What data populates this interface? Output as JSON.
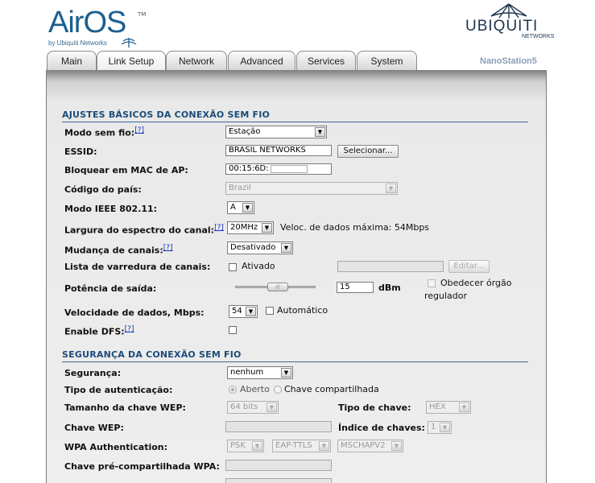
{
  "header": {
    "airos_logo": "AirOS",
    "airos_tm": "TM",
    "airos_sub": "by Ubiquiti Networks",
    "ubnt_logo": "UBIQUITI",
    "ubnt_sub": "NETWORKS",
    "device_name": "NanoStation5"
  },
  "tabs": [
    "Main",
    "Link Setup",
    "Network",
    "Advanced",
    "Services",
    "System"
  ],
  "wireless": {
    "title": "AJUSTES BÁSICOS DA CONEXÃO SEM FIO",
    "mode_label": "Modo sem fio:",
    "help": "[?]",
    "mode_value": "Estação",
    "essid_label": "ESSID:",
    "essid_value": "BRASIL NETWORKS",
    "select_button": "Selecionar...",
    "lock_label": "Bloquear em MAC de AP:",
    "lock_value": "00:15:6D:",
    "country_label": "Código do país:",
    "country_value": "Brazil",
    "ieee_label": "Modo IEEE 802.11:",
    "ieee_value": "A",
    "width_label": "Largura do espectro do canal:",
    "width_value": "20MHz",
    "max_rate": "Veloc. de dados máxima: 54Mbps",
    "shift_label": "Mudança de canais:",
    "shift_value": "Desativado",
    "scan_label": "Lista de varredura de canais:",
    "scan_checkbox": "Ativado",
    "edit_button": "Editar...",
    "power_label": "Potência de saída:",
    "power_value": "15",
    "power_unit": "dBm",
    "obey_line1": "Obedecer órgão",
    "obey_line2": "regulador",
    "rate_label": "Velocidade de dados, Mbps:",
    "rate_value": "54",
    "auto_label": "Automático",
    "dfs_label": "Enable DFS:"
  },
  "security": {
    "title": "SEGURANÇA DA CONEXÃO SEM FIO",
    "security_label": "Segurança:",
    "security_value": "nenhum",
    "auth_label": "Tipo de autenticação:",
    "auth_open": "Aberto",
    "auth_shared": "Chave compartilhada",
    "wep_size_label": "Tamanho da chave WEP:",
    "wep_size_value": "64 bits",
    "key_type_label": "Tipo de chave:",
    "key_type_value": "HEX",
    "wep_key_label": "Chave WEP:",
    "key_index_label": "Índice de chaves:",
    "key_index_value": "1",
    "wpa_auth_label": "WPA Authentication:",
    "wpa_psk": "PSK",
    "wpa_eap": "EAP-TTLS",
    "wpa_mschap": "MSCHAPV2",
    "wpa_key_label": "Chave pré-compartilhada WPA:"
  }
}
